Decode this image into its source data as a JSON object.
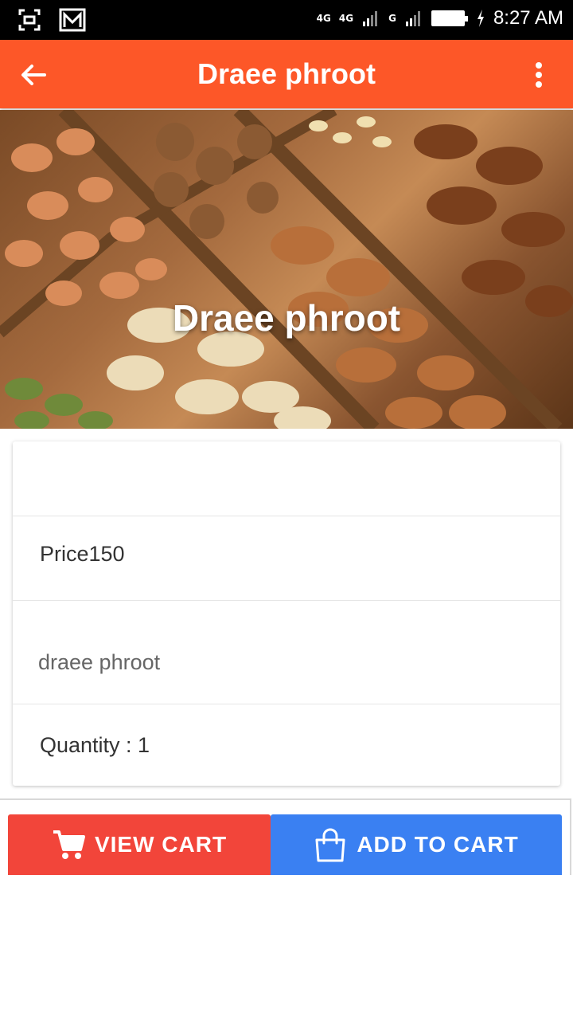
{
  "status_bar": {
    "network_1": "4G",
    "network_2": "4G",
    "network_3": "G",
    "time": "8:27 AM",
    "icons": [
      "screenshot-icon",
      "gmail-icon",
      "volte-icon",
      "signal-icon",
      "signal-icon",
      "battery-icon",
      "charging-icon"
    ]
  },
  "app_bar": {
    "title": "Draee phroot",
    "back_icon": "arrow-back-icon",
    "menu_icon": "more-vert-icon",
    "background": "#fd5728"
  },
  "hero": {
    "title": "Draee phroot"
  },
  "product": {
    "price": "Price150",
    "description": "draee phroot",
    "quantity": "Quantity : 1"
  },
  "actions": {
    "view_cart_label": "VIEW CART",
    "add_to_cart_label": "ADD TO CART",
    "view_cart_color": "#f2453a",
    "add_to_cart_color": "#3a80f2"
  }
}
